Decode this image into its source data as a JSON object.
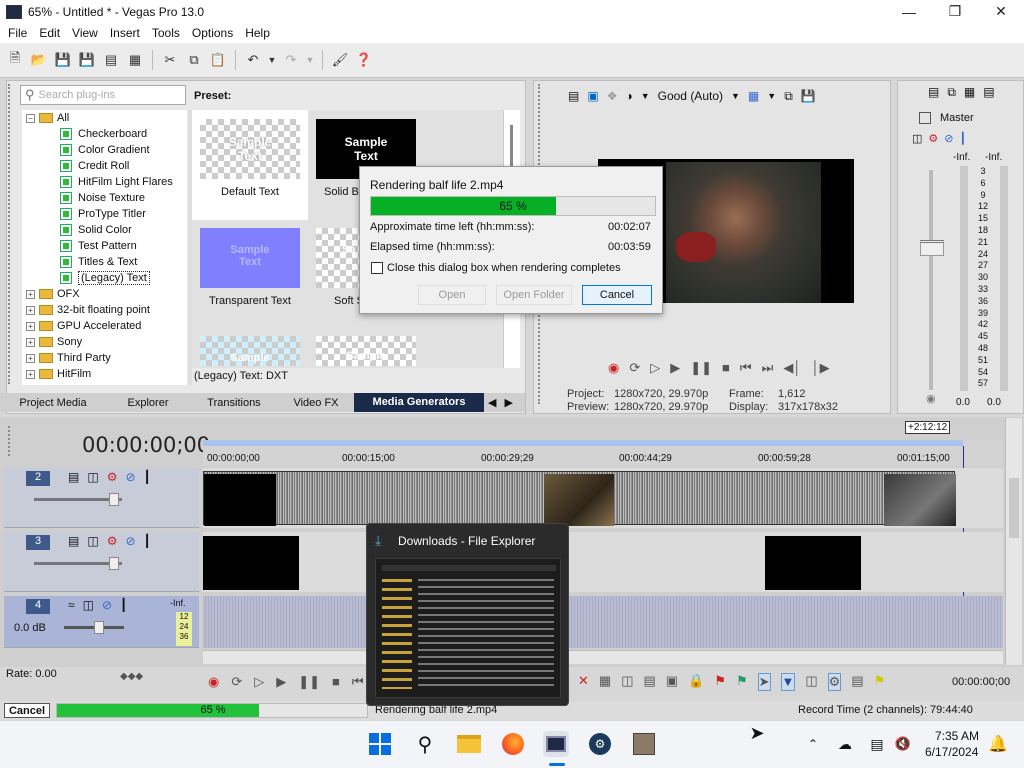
{
  "window": {
    "title": "65% - Untitled * - Vegas Pro 13.0"
  },
  "menu": [
    "File",
    "Edit",
    "View",
    "Insert",
    "Tools",
    "Options",
    "Help"
  ],
  "explorer": {
    "search_placeholder": "Search plug-ins",
    "preset_label": "Preset:",
    "tree": [
      {
        "label": "All",
        "level": 0,
        "expanded": true,
        "type": "folder"
      },
      {
        "label": "Checkerboard",
        "level": 1,
        "type": "gen"
      },
      {
        "label": "Color Gradient",
        "level": 1,
        "type": "gen"
      },
      {
        "label": "Credit Roll",
        "level": 1,
        "type": "gen"
      },
      {
        "label": "HitFilm Light Flares",
        "level": 1,
        "type": "gen"
      },
      {
        "label": "Noise Texture",
        "level": 1,
        "type": "gen"
      },
      {
        "label": "ProType Titler",
        "level": 1,
        "type": "gen"
      },
      {
        "label": "Solid Color",
        "level": 1,
        "type": "gen"
      },
      {
        "label": "Test Pattern",
        "level": 1,
        "type": "gen"
      },
      {
        "label": "Titles & Text",
        "level": 1,
        "type": "gen"
      },
      {
        "label": "(Legacy) Text",
        "level": 1,
        "type": "gen",
        "selected": true
      },
      {
        "label": "OFX",
        "level": 0,
        "type": "folder"
      },
      {
        "label": "32-bit floating point",
        "level": 0,
        "type": "folder"
      },
      {
        "label": "GPU Accelerated",
        "level": 0,
        "type": "folder"
      },
      {
        "label": "Sony",
        "level": 0,
        "type": "folder"
      },
      {
        "label": "Third Party",
        "level": 0,
        "type": "folder"
      },
      {
        "label": "HitFilm",
        "level": 0,
        "type": "folder"
      }
    ],
    "presets": [
      {
        "name": "Default Text",
        "thumb": "Sample\nText"
      },
      {
        "name": "Solid Ba",
        "thumb": "Sample\nText"
      },
      {
        "name": "Transparent Text",
        "thumb": "Sample\nText"
      },
      {
        "name": "Soft S",
        "thumb": "Sa"
      },
      {
        "name": "",
        "thumb": "Sample"
      },
      {
        "name": "",
        "thumb": "Sample"
      }
    ],
    "footer": "(Legacy) Text: DXT",
    "tabs": [
      "Project Media",
      "Explorer",
      "Transitions",
      "Video FX",
      "Media Generators"
    ],
    "active_tab": "Media Generators"
  },
  "preview": {
    "quality": "Good (Auto)",
    "project": "Project:",
    "project_val": "1280x720, 29.970p",
    "preview_lbl": "Preview:",
    "preview_val": "1280x720, 29.970p",
    "frame_lbl": "Frame:",
    "frame_val": "1,612",
    "display_lbl": "Display:",
    "display_val": "317x178x32"
  },
  "master": {
    "label": "Master",
    "inf_left": "-Inf.",
    "inf_right": "-Inf.",
    "scale": [
      "3",
      "6",
      "9",
      "12",
      "15",
      "18",
      "21",
      "24",
      "27",
      "30",
      "33",
      "36",
      "39",
      "42",
      "45",
      "48",
      "51",
      "54",
      "57"
    ],
    "val_left": "0.0",
    "val_right": "0.0"
  },
  "render": {
    "file": "Rendering balf life 2.mp4",
    "progress_text": "65 %",
    "progress": 0.65,
    "time_left_label": "Approximate time left (hh:mm:ss):",
    "time_left": "00:02:07",
    "elapsed_label": "Elapsed time (hh:mm:ss):",
    "elapsed": "00:03:59",
    "close_label": "Close this dialog box when rendering completes",
    "open": "Open",
    "open_folder": "Open Folder",
    "cancel": "Cancel"
  },
  "timeline": {
    "timecode": "00:00:00;00",
    "end_marker": "+2:12:12",
    "ruler": [
      "00:00:00;00",
      "00:00:15;00",
      "00:00:29;29",
      "00:00:44;29",
      "00:00:59;28",
      "00:01:15;00"
    ],
    "tracks": [
      {
        "num": "2"
      },
      {
        "num": "3"
      },
      {
        "num": "4",
        "vol": "0.0 dB"
      }
    ],
    "track4_inf": "-Inf.",
    "track4_scale": [
      "12",
      "24",
      "36"
    ],
    "rate": "Rate: 0.00",
    "end_time": "00:00:00;00"
  },
  "status": {
    "cancel": "Cancel",
    "progress_text": "65 %",
    "progress": 0.65,
    "rendering": "Rendering balf life 2.mp4",
    "record_time": "Record Time (2 channels): 79:44:40"
  },
  "taskbar_popup": {
    "title": "Downloads - File Explorer"
  },
  "clock": {
    "time": "7:35 AM",
    "date": "6/17/2024"
  }
}
